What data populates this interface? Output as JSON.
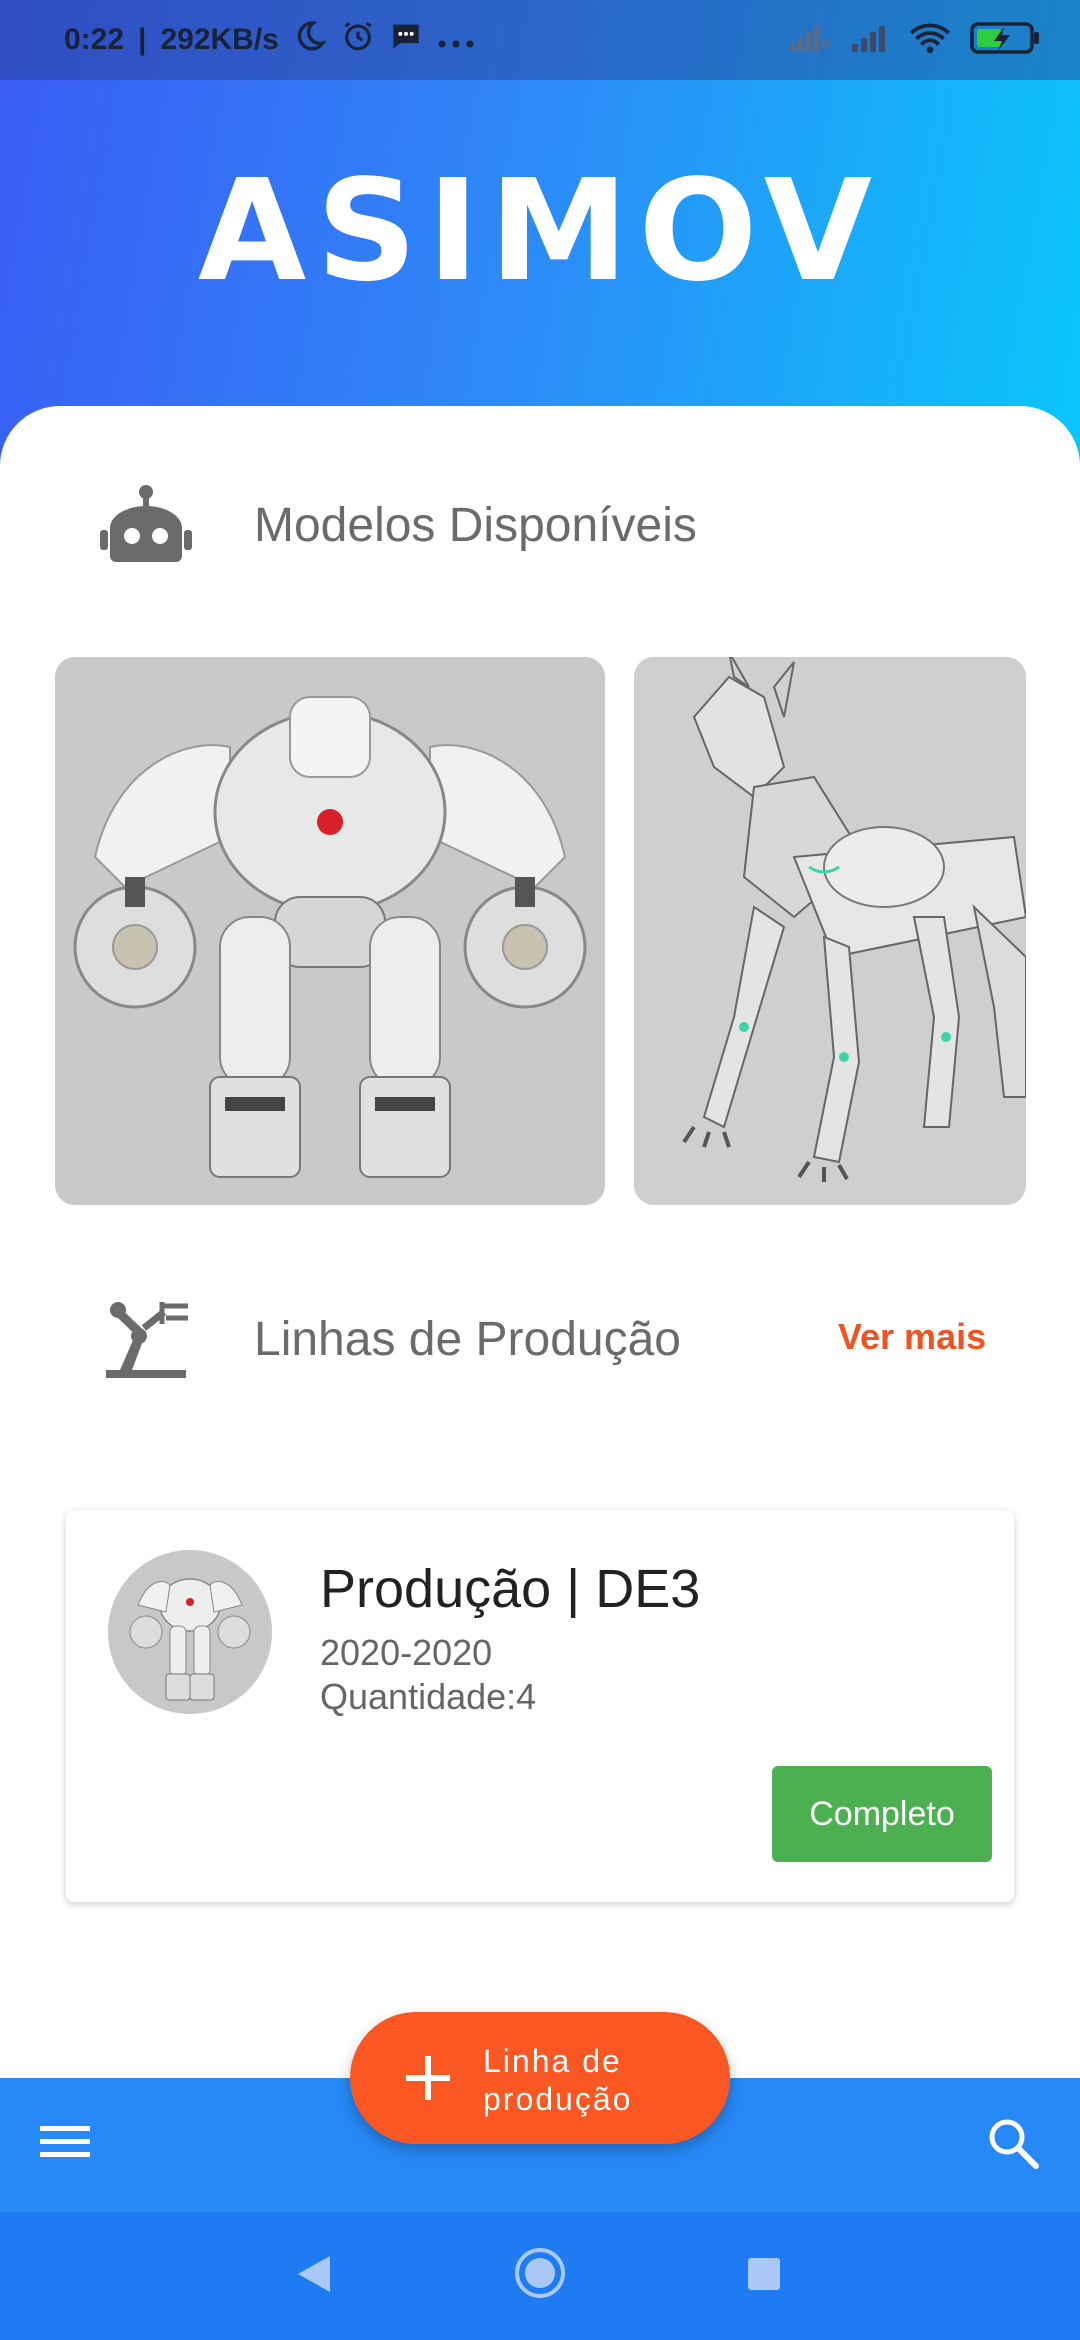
{
  "status_bar": {
    "time": "0:22",
    "network_speed": "292KB/s",
    "icons": [
      "moon-icon",
      "alarm-icon",
      "message-icon",
      "more-icon",
      "signal-x-icon",
      "signal-icon",
      "wifi-icon",
      "battery-charging-icon"
    ]
  },
  "header": {
    "logo": "ASIMOV"
  },
  "models": {
    "title": "Modelos Disponíveis",
    "icon": "robot-icon",
    "items": [
      {
        "name": "humanoid-robot"
      },
      {
        "name": "robot-dog"
      }
    ]
  },
  "production": {
    "title": "Linhas de Produção",
    "icon": "robotic-arm-icon",
    "see_more": "Ver mais",
    "cards": [
      {
        "title": "Produção | DE3",
        "years": "2020-2020",
        "quantity": "Quantidade:4",
        "status": "Completo"
      }
    ]
  },
  "fab": {
    "label_line1": "Linha de",
    "label_line2": "produção",
    "icon": "plus-icon"
  },
  "bottom_bar": {
    "left_icon": "menu-icon",
    "right_icon": "search-icon"
  },
  "nav_bar": {
    "icons": [
      "back-icon",
      "home-icon",
      "recents-icon"
    ]
  },
  "colors": {
    "accent": "#fb5722",
    "primary": "#2689f7",
    "success": "#4caf50"
  }
}
